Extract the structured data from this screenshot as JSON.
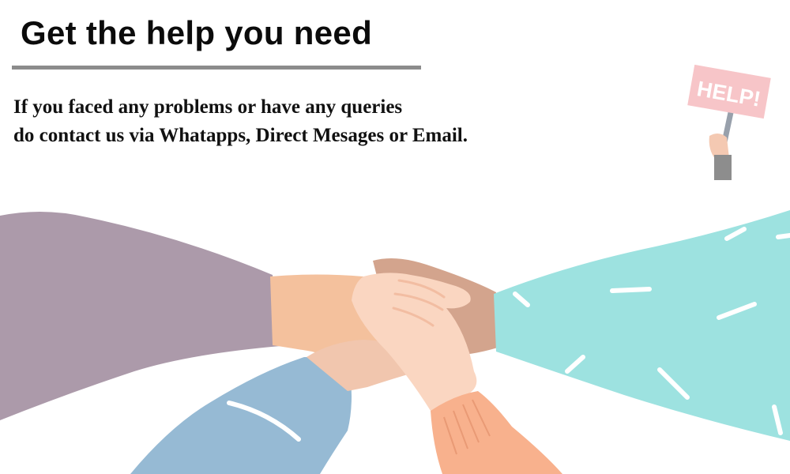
{
  "heading": "Get the help you need",
  "description": {
    "line1": "If you faced any problems or have any queries",
    "line2": "do contact us via Whatapps, Direct Mesages or Email."
  },
  "help_sign": {
    "icon": "help-sign-icon",
    "text": "HELP!"
  },
  "illustration": {
    "icon": "stacked-hands-illustration"
  },
  "colors": {
    "heading": "#0b0b0b",
    "rule": "#8c8c8c",
    "purple_sleeve": "#ac9aaa",
    "teal_sleeve": "#9de2e0",
    "blue_sleeve": "#96bad4",
    "peach_sleeve": "#f8b18d",
    "sign": "#f7c5c8"
  }
}
